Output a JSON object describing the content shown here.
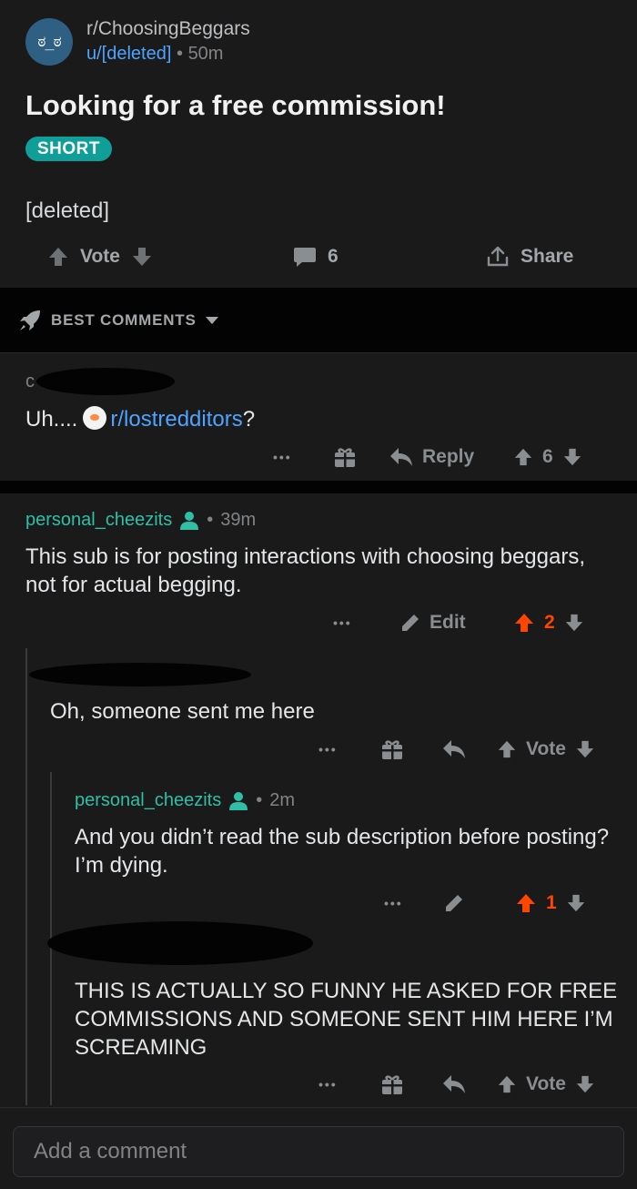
{
  "post": {
    "avatar_glyph": "ಠ_ಠ",
    "subreddit": "r/ChoosingBeggars",
    "author": "u/[deleted]",
    "separator": "•",
    "age": "50m",
    "title": "Looking for a free commission!",
    "flair": "SHORT",
    "body": "[deleted]",
    "vote_label": "Vote",
    "comment_count": "6",
    "share_label": "Share"
  },
  "sort": {
    "label": "BEST COMMENTS"
  },
  "comments": [
    {
      "author": "c",
      "text_prefix": "Uh....",
      "link": "r/lostredditors",
      "text_suffix": "?",
      "more": "•••",
      "reply_label": "Reply",
      "score": "6"
    },
    {
      "author": "personal_cheezits",
      "separator": "•",
      "age": "39m",
      "text": "This sub is for posting interactions with choosing beggars, not for actual begging.",
      "more": "•••",
      "edit_label": "Edit",
      "score": "2"
    },
    {
      "text": "Oh, someone sent me here",
      "more": "•••",
      "vote_label": "Vote"
    },
    {
      "author": "personal_cheezits",
      "separator": "•",
      "age": "2m",
      "text": "And you didn’t read the sub description before posting? I’m dying.",
      "more": "•••",
      "score": "1"
    },
    {
      "text": "THIS IS ACTUALLY SO FUNNY HE ASKED FOR FREE COMMISSIONS AND SOMEONE SENT HIM HERE I’M SCREAMING",
      "more": "•••",
      "vote_label": "Vote"
    }
  ],
  "composer": {
    "placeholder": "Add a comment"
  },
  "colors": {
    "accent_blue": "#4fa3ff",
    "username_teal": "#2fbfa6",
    "upvote_orange": "#ff4500",
    "flair_teal": "#0f9f98"
  }
}
